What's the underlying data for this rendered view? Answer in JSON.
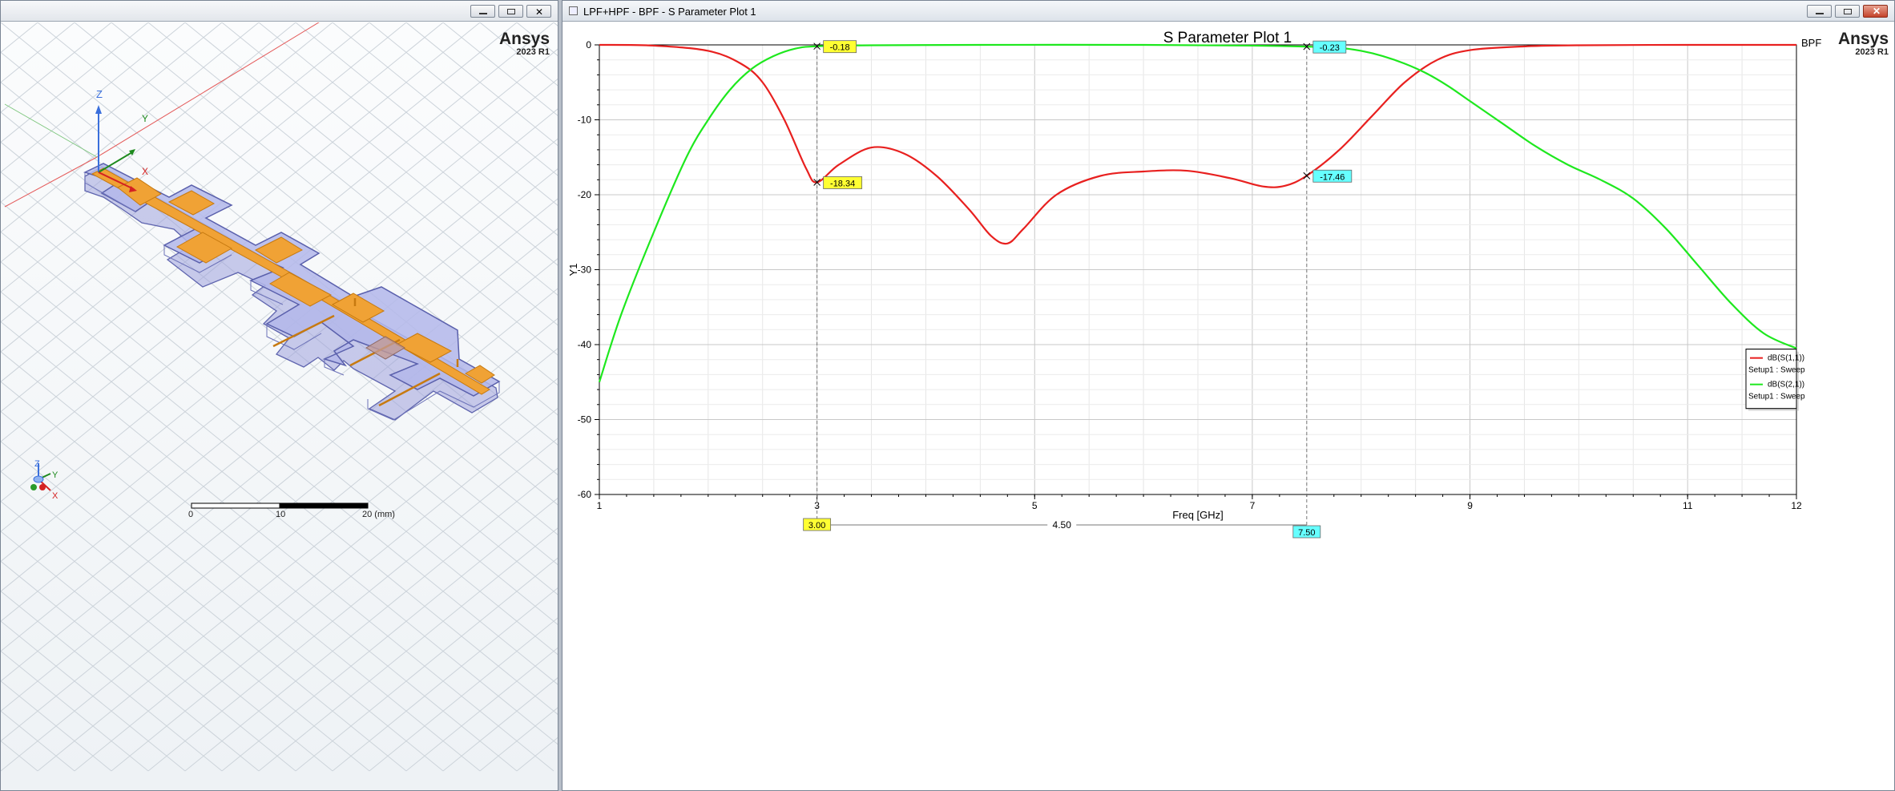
{
  "left_window": {
    "title": "",
    "brand": "Ansys",
    "version": "2023 R1",
    "axis_labels": {
      "z": "Z",
      "y": "Y",
      "x": "X"
    },
    "scale_bar": {
      "ticks": [
        "0",
        "10",
        "20 (mm)"
      ]
    },
    "colors": {
      "substrate": "#aeb4e8",
      "copper": "#f0a030",
      "grid": "#c8cfd6"
    }
  },
  "right_window": {
    "title": "LPF+HPF - BPF - S Parameter Plot 1",
    "brand": "Ansys",
    "version": "2023 R1",
    "design_label": "BPF"
  },
  "chart_data": {
    "type": "line",
    "title": "S Parameter Plot 1",
    "xlabel": "Freq [GHz]",
    "ylabel": "Y1",
    "xlim": [
      1,
      12
    ],
    "ylim": [
      -60,
      0
    ],
    "xticks": [
      "1",
      "3",
      "5",
      "7",
      "9",
      "11",
      "12"
    ],
    "yticks": [
      "0",
      "-10",
      "-20",
      "-30",
      "-40",
      "-50",
      "-60"
    ],
    "grid": true,
    "series": [
      {
        "name": "dB(S(1,1))",
        "subname": "Setup1 : Sweep",
        "color": "#e8201f",
        "x": [
          1.0,
          1.5,
          2.0,
          2.3,
          2.5,
          2.7,
          2.9,
          3.0,
          3.2,
          3.5,
          3.8,
          4.1,
          4.4,
          4.6,
          4.75,
          4.9,
          5.2,
          5.6,
          6.0,
          6.4,
          6.8,
          7.1,
          7.3,
          7.5,
          7.8,
          8.1,
          8.4,
          8.7,
          9.0,
          9.5,
          10.0,
          11.0,
          12.0
        ],
        "y": [
          0.0,
          -0.1,
          -0.8,
          -2.5,
          -5.0,
          -10.0,
          -16.5,
          -18.34,
          -16.0,
          -13.7,
          -14.5,
          -17.5,
          -22.0,
          -25.5,
          -26.5,
          -24.5,
          -20.0,
          -17.5,
          -16.9,
          -16.8,
          -17.8,
          -18.9,
          -18.8,
          -17.46,
          -14.0,
          -9.5,
          -5.0,
          -2.0,
          -0.7,
          -0.2,
          -0.05,
          0.0,
          0.0
        ]
      },
      {
        "name": "dB(S(2,1))",
        "subname": "Setup1 : Sweep",
        "color": "#1ee81e",
        "x": [
          1.0,
          1.2,
          1.5,
          1.8,
          2.0,
          2.2,
          2.4,
          2.6,
          2.8,
          3.0,
          3.5,
          4.5,
          6.0,
          7.0,
          7.5,
          7.8,
          8.0,
          8.2,
          8.4,
          8.6,
          8.8,
          9.0,
          9.3,
          9.6,
          9.9,
          10.2,
          10.5,
          10.8,
          11.1,
          11.4,
          11.7,
          12.0
        ],
        "y": [
          -45.0,
          -36.0,
          -25.0,
          -15.0,
          -10.0,
          -6.0,
          -3.2,
          -1.5,
          -0.5,
          -0.18,
          -0.05,
          0.0,
          0.0,
          -0.1,
          -0.23,
          -0.4,
          -0.8,
          -1.5,
          -2.5,
          -3.8,
          -5.5,
          -7.5,
          -10.5,
          -13.5,
          -16.0,
          -18.0,
          -20.5,
          -24.5,
          -29.5,
          -34.5,
          -38.5,
          -40.5
        ]
      }
    ],
    "markers": [
      {
        "label": "-18.34",
        "series": 0,
        "x": 3.0,
        "y": -18.34,
        "color": "#ffff33"
      },
      {
        "label": "-0.18",
        "series": 1,
        "x": 3.0,
        "y": -0.18,
        "color": "#ffff33"
      },
      {
        "label": "-17.46",
        "series": 0,
        "x": 7.5,
        "y": -17.46,
        "color": "#66ffff"
      },
      {
        "label": "-0.23",
        "series": 1,
        "x": 7.5,
        "y": -0.23,
        "color": "#66ffff"
      }
    ],
    "delta": {
      "x1": 3.0,
      "x2": 7.5,
      "x1_label": "3.00",
      "x2_label": "7.50",
      "delta_label": "4.50"
    }
  }
}
